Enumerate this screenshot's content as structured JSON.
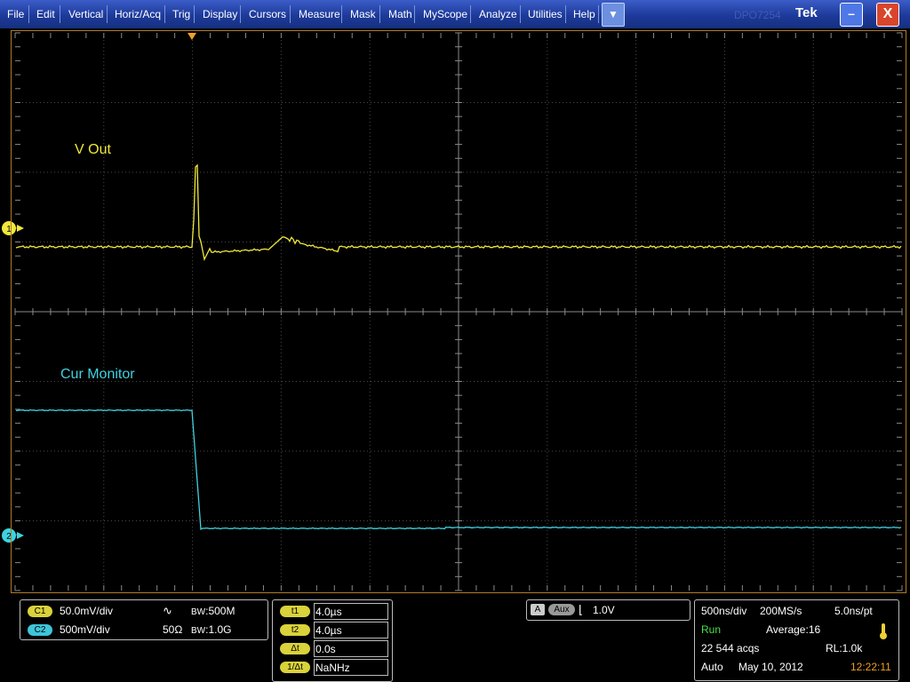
{
  "menubar": {
    "items": [
      "File",
      "Edit",
      "Vertical",
      "Horiz/Acq",
      "Trig",
      "Display",
      "Cursors",
      "Measure",
      "Mask",
      "Math",
      "MyScope",
      "Analyze",
      "Utilities",
      "Help"
    ],
    "dropdown_icon": "down-triangle-icon",
    "faint_text": "DPO7254",
    "brand": "Tek",
    "minimize_label": "–",
    "close_label": "X"
  },
  "colors": {
    "ch1": "#f0e83a",
    "ch2": "#3ed2e0",
    "grid_frame": "#b07a28",
    "menubar": "#1d3a9a"
  },
  "markers": {
    "ch1_marker": "1",
    "ch2_marker": "2",
    "trigger_marker_icon": "trigger-position-triangle-icon"
  },
  "traces": {
    "ch1_label": "V Out",
    "ch2_label": "Cur Monitor"
  },
  "channels": {
    "c1": {
      "badge": "C1",
      "scale": "50.0mV/div",
      "coupling_icon": "dc-coupling-icon",
      "bw_label": "BW",
      "bw_value": ":500M"
    },
    "c2": {
      "badge": "C2",
      "scale": "500mV/div",
      "impedance": "50Ω",
      "bw_label": "BW",
      "bw_value": ":1.0G"
    }
  },
  "cursors": [
    {
      "label": "t1",
      "value": "4.0µs"
    },
    {
      "label": "t2",
      "value": "4.0µs"
    },
    {
      "label": "Δt",
      "value": "0.0s"
    },
    {
      "label": "1/Δt",
      "value": "NaNHz"
    }
  ],
  "trigger": {
    "source_badge": "A",
    "aux_badge": "Aux",
    "slope_icon": "falling-edge-icon",
    "level": "1.0V"
  },
  "acquisition": {
    "timebase": "500ns/div",
    "sample_rate": "200MS/s",
    "resolution": "5.0ns/pt",
    "state": "Run",
    "mode": "Average:16",
    "acqs": "22 544 acqs",
    "record_length": "RL:1.0k",
    "trigger_mode": "Auto",
    "date": "May 10, 2012",
    "time": "12:22:11",
    "thermometer_icon": "thermometer-icon"
  }
}
